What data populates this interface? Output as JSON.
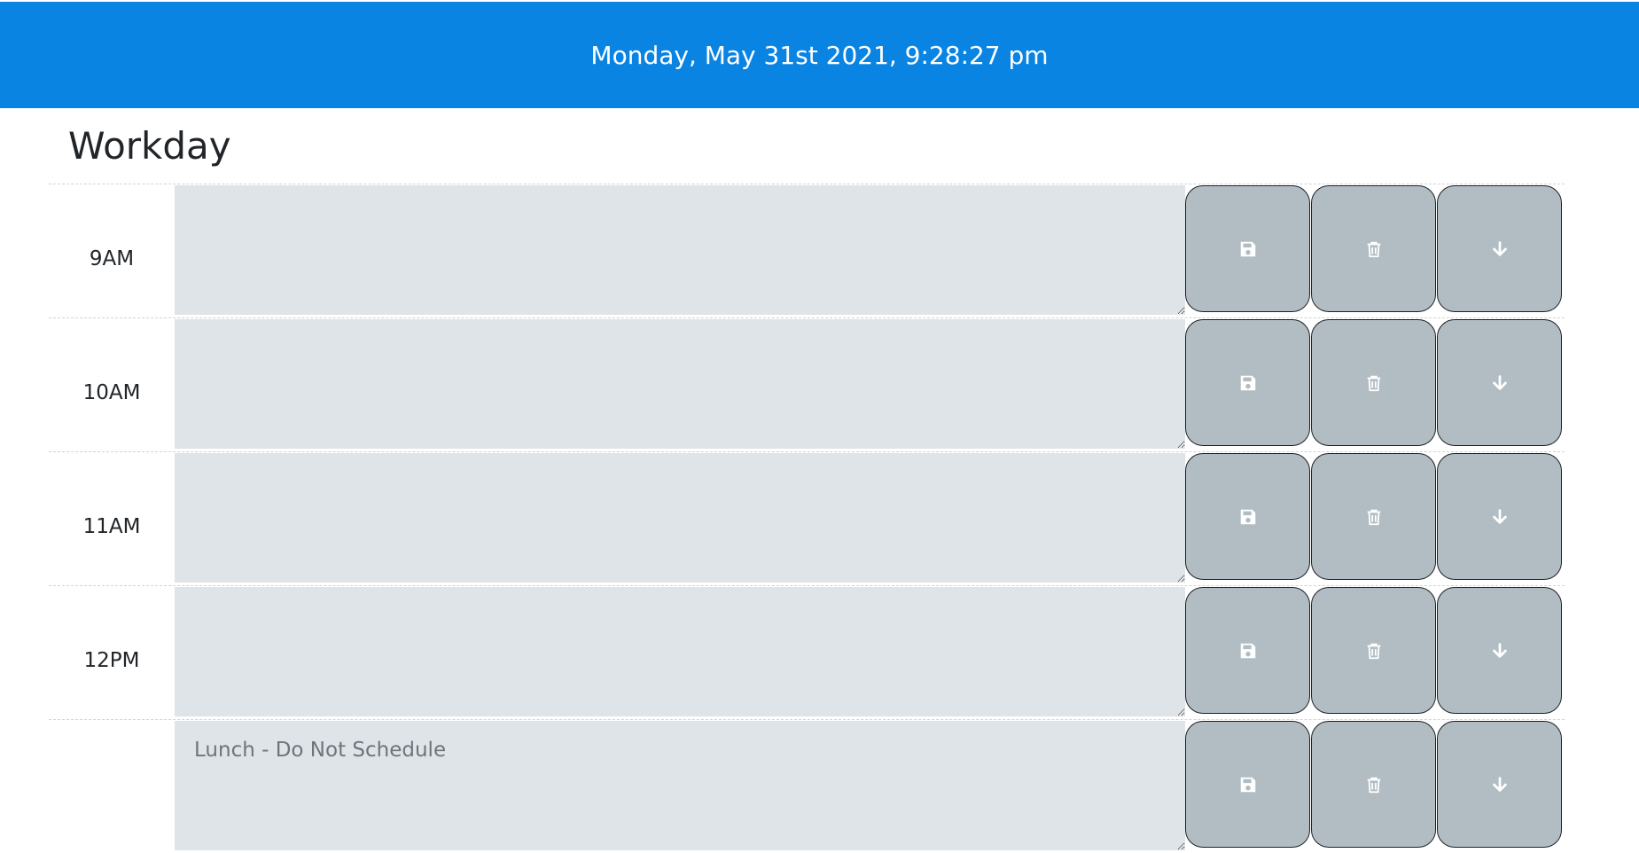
{
  "header": {
    "datetime": "Monday, May 31st 2021, 9:28:27 pm",
    "background": "#0a84e2"
  },
  "page": {
    "title": "Workday"
  },
  "rows": [
    {
      "hour": "9AM",
      "text": "",
      "placeholder": ""
    },
    {
      "hour": "10AM",
      "text": "",
      "placeholder": ""
    },
    {
      "hour": "11AM",
      "text": "",
      "placeholder": ""
    },
    {
      "hour": "12PM",
      "text": "",
      "placeholder": ""
    },
    {
      "hour": "",
      "text": "",
      "placeholder": "Lunch - Do Not Schedule"
    }
  ],
  "icons": {
    "save": "save-icon",
    "delete": "trash-icon",
    "move_down": "arrow-down-icon"
  },
  "colors": {
    "textarea_bg": "#dee4e8",
    "button_bg": "#b2bdc3"
  }
}
